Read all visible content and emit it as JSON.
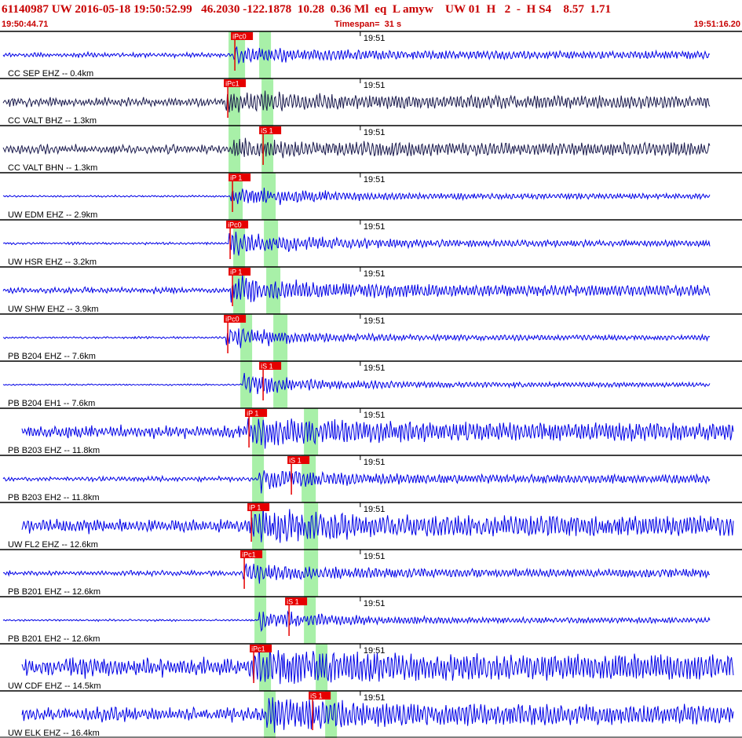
{
  "header": {
    "title": "61140987 UW 2016-05-18 19:50:52.99   46.2030 -122.1878  10.28  0.36 Ml  eq  L amyw    UW 01  H   2  -  H S4    8.57  1.71",
    "start_time": "19:50:44.71",
    "timespan": "Timespan=  31 s",
    "end_time": "19:51:16.20"
  },
  "colors": {
    "header_text": "#c80000",
    "trace": "#0000e6",
    "trace_dark": "#1a1a4d",
    "pick": "#e60000",
    "pick_window": "#a8f0a8",
    "divider": "#000000",
    "label": "#000000"
  },
  "chart_data": {
    "type": "line",
    "title": "61140987 UW 2016-05-18 19:50:52.99   46.2030 -122.1878  10.28  0.36 Ml  eq  L amyw    UW 01  H   2  -  H S4    8.57  1.71",
    "x_unit": "seconds after 19:50:44.71",
    "xlim": [
      0,
      31.49
    ],
    "minute_marker": {
      "label": "19:51",
      "t": 15.29
    },
    "series": [
      {
        "name": "CC SEP EHZ -- 0.4km",
        "color": "#0000e6",
        "amp": 0.25,
        "pre": 0.1,
        "picks": [
          {
            "label": "iPc0",
            "t": 9.9,
            "band": [
              9.7,
              10.4
            ]
          },
          {
            "label": "",
            "t": 11.1,
            "band": [
              11.0,
              11.5
            ]
          }
        ]
      },
      {
        "name": "CC VALT BHZ -- 1.3km",
        "color": "#1a1a4d",
        "amp": 0.3,
        "pre": 0.18,
        "picks": [
          {
            "label": "iPc1",
            "t": 9.6,
            "band": [
              9.7,
              10.2
            ]
          },
          {
            "label": "",
            "t": 11.2,
            "band": [
              11.1,
              11.6
            ]
          }
        ]
      },
      {
        "name": "CC VALT BHN -- 1.3km",
        "color": "#1a1a4d",
        "amp": 0.28,
        "pre": 0.18,
        "picks": [
          {
            "label": "iS 1",
            "t": 11.1,
            "band": [
              11.1,
              11.6
            ]
          },
          {
            "label": "",
            "t": 9.9,
            "band": [
              9.7,
              10.2
            ]
          }
        ]
      },
      {
        "name": "UW EDM EHZ -- 2.9km",
        "color": "#0000e6",
        "amp": 0.4,
        "pre": 0.04,
        "picks": [
          {
            "label": "iP 1",
            "t": 9.8,
            "band": [
              9.7,
              10.3
            ]
          },
          {
            "label": "",
            "t": 11.3,
            "band": [
              11.1,
              11.7
            ]
          }
        ]
      },
      {
        "name": "UW HSR EHZ -- 3.2km",
        "color": "#0000e6",
        "amp": 0.45,
        "pre": 0.05,
        "picks": [
          {
            "label": "iPc0",
            "t": 9.7,
            "band": [
              9.9,
              10.4
            ]
          },
          {
            "label": "",
            "t": 11.3,
            "band": [
              11.2,
              11.8
            ]
          }
        ]
      },
      {
        "name": "UW SHW EHZ -- 3.9km",
        "color": "#0000e6",
        "amp": 0.5,
        "pre": 0.12,
        "picks": [
          {
            "label": "iP 1",
            "t": 9.8,
            "band": [
              9.9,
              10.4
            ]
          },
          {
            "label": "",
            "t": 11.5,
            "band": [
              11.3,
              11.9
            ]
          }
        ]
      },
      {
        "name": "PB B204 EHZ -- 7.6km",
        "color": "#0000e6",
        "amp": 0.38,
        "pre": 0.04,
        "picks": [
          {
            "label": "iPc0",
            "t": 9.6,
            "band": [
              10.2,
              10.7
            ]
          },
          {
            "label": "",
            "t": 11.8,
            "band": [
              11.6,
              12.2
            ]
          }
        ]
      },
      {
        "name": "PB B204 EH1 -- 7.6km",
        "color": "#0000e6",
        "amp": 0.4,
        "pre": 0.03,
        "picks": [
          {
            "label": "iS 1",
            "t": 11.1,
            "band": [
              11.6,
              12.2
            ]
          },
          {
            "label": "",
            "t": 10.3,
            "band": [
              10.2,
              10.7
            ]
          }
        ]
      },
      {
        "name": "PB B203 EHZ -- 11.8km",
        "color": "#0000e6",
        "amp": 0.45,
        "pre": 0.25,
        "picks": [
          {
            "label": "iP 1",
            "t": 10.5,
            "band": [
              10.7,
              11.2
            ]
          },
          {
            "label": "",
            "t": 13.2,
            "band": [
              12.9,
              13.5
            ]
          }
        ]
      },
      {
        "name": "PB B203 EH2 -- 11.8km",
        "color": "#0000e6",
        "amp": 0.35,
        "pre": 0.1,
        "picks": [
          {
            "label": "iS 1",
            "t": 12.3,
            "band": [
              12.8,
              13.4
            ]
          },
          {
            "label": "",
            "t": 11.0,
            "band": [
              10.7,
              11.2
            ]
          }
        ]
      },
      {
        "name": "UW FL2 EHZ -- 12.6km",
        "color": "#0000e6",
        "amp": 0.45,
        "pre": 0.28,
        "picks": [
          {
            "label": "iP 1",
            "t": 10.6,
            "band": [
              10.7,
              11.2
            ]
          },
          {
            "label": "",
            "t": 13.1,
            "band": [
              12.9,
              13.5
            ]
          }
        ]
      },
      {
        "name": "PB B201 EHZ -- 12.6km",
        "color": "#0000e6",
        "amp": 0.3,
        "pre": 0.1,
        "picks": [
          {
            "label": "iPc1",
            "t": 10.3,
            "band": [
              10.8,
              11.3
            ]
          },
          {
            "label": "",
            "t": 13.2,
            "band": [
              12.9,
              13.5
            ]
          }
        ]
      },
      {
        "name": "PB B201 EH2 -- 12.6km",
        "color": "#0000e6",
        "amp": 0.4,
        "pre": 0.04,
        "picks": [
          {
            "label": "iS 1",
            "t": 12.2,
            "band": [
              12.9,
              13.4
            ]
          },
          {
            "label": "",
            "t": 11.0,
            "band": [
              10.8,
              11.3
            ]
          }
        ]
      },
      {
        "name": "UW CDF EHZ -- 14.5km",
        "color": "#0000e6",
        "amp": 0.45,
        "pre": 0.38,
        "picks": [
          {
            "label": "iPc1",
            "t": 10.7,
            "band": [
              11.0,
              11.5
            ]
          },
          {
            "label": "",
            "t": 13.6,
            "band": [
              13.4,
              13.9
            ]
          }
        ]
      },
      {
        "name": "UW ELK EHZ -- 16.4km",
        "color": "#0000e6",
        "amp": 0.45,
        "pre": 0.28,
        "picks": [
          {
            "label": "iS 1",
            "t": 13.2,
            "band": [
              13.8,
              14.3
            ]
          },
          {
            "label": "",
            "t": 11.3,
            "band": [
              11.2,
              11.7
            ]
          }
        ]
      }
    ]
  }
}
